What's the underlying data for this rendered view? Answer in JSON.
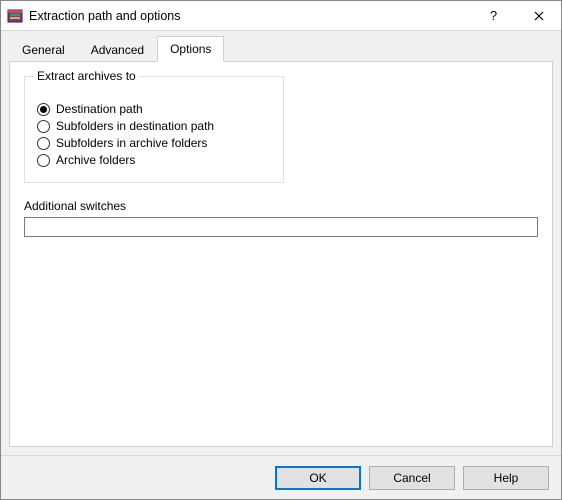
{
  "window": {
    "title": "Extraction path and options"
  },
  "tabs": {
    "general": "General",
    "advanced": "Advanced",
    "options": "Options"
  },
  "group": {
    "legend": "Extract archives to",
    "opt_destination": "Destination path",
    "opt_subfolders_dest": "Subfolders in destination path",
    "opt_subfolders_arch": "Subfolders in archive folders",
    "opt_archive_folders": "Archive folders"
  },
  "switches": {
    "label": "Additional switches",
    "value": ""
  },
  "buttons": {
    "ok": "OK",
    "cancel": "Cancel",
    "help": "Help"
  }
}
